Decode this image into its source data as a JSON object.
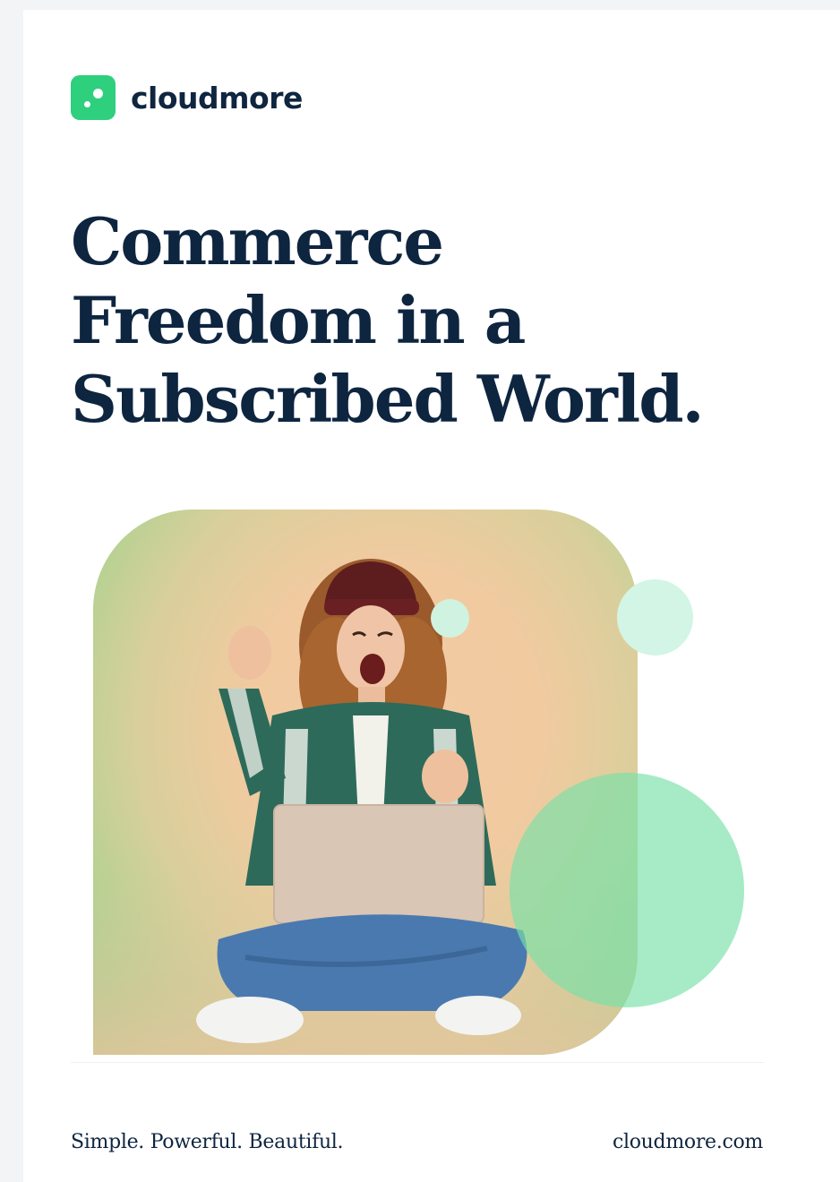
{
  "brand": {
    "name": "cloudmore",
    "logo_icon": "cloudmore-dots-logo",
    "color": "#2ecf7d"
  },
  "headline": {
    "lines": [
      "Commerce",
      "Freedom in a",
      "Subscribed World."
    ],
    "color": "#0e2540"
  },
  "hero": {
    "image": "woman-celebrating-with-laptop-photo"
  },
  "footer": {
    "tagline": "Simple. Powerful. Beautiful.",
    "website": "cloudmore.com"
  }
}
